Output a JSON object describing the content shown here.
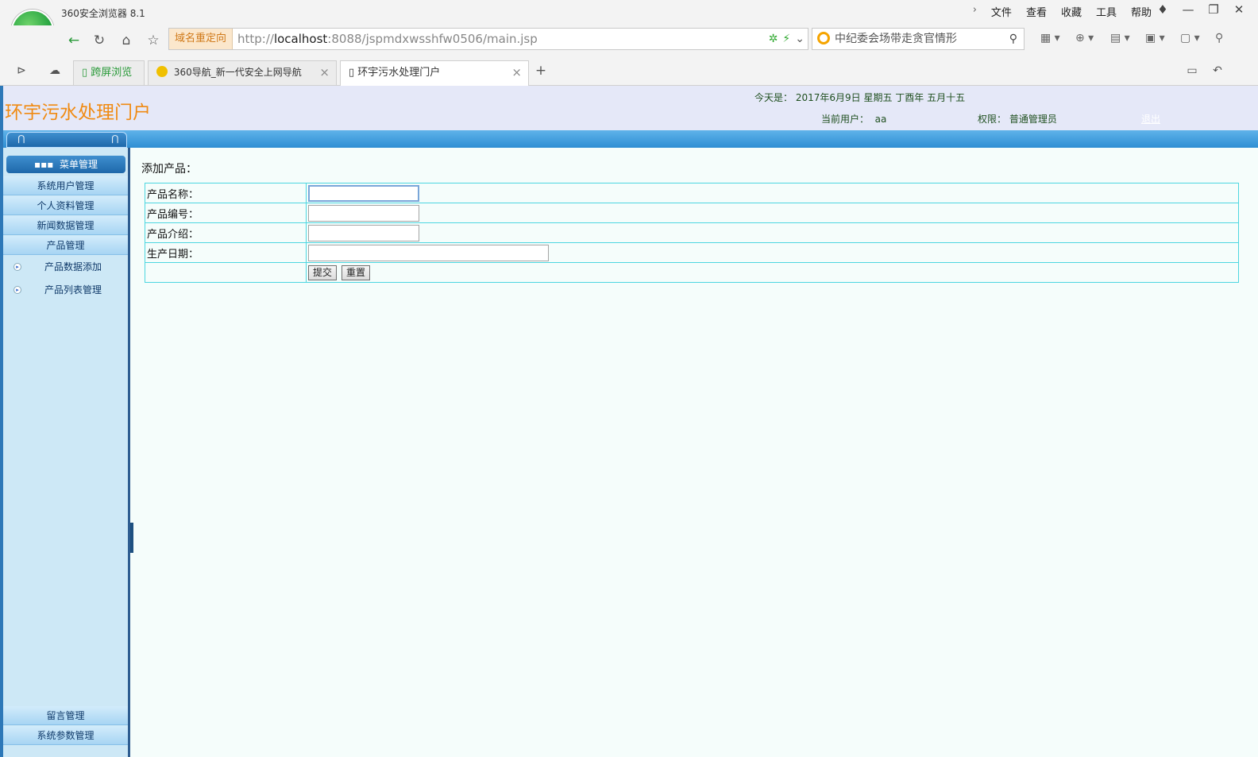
{
  "browser": {
    "app_title": "360安全浏览器 8.1",
    "logo_letter": "e",
    "menu": [
      "文件",
      "查看",
      "收藏",
      "工具",
      "帮助"
    ],
    "window_controls": [
      "shirt-icon",
      "minimize-icon",
      "restore-icon",
      "close-icon"
    ],
    "redirect_label": "域名重定向",
    "url_prefix": "http://",
    "url_host": "localhost",
    "url_rest": ":8088/jspmdxwsshfw0506/main.jsp",
    "search_text": "中纪委会场带走贪官情形",
    "tabs": [
      {
        "label": "跨屏浏览",
        "active": false
      },
      {
        "label": "360导航_新一代安全上网导航",
        "active": false
      },
      {
        "label": "环宇污水处理门户",
        "active": true
      }
    ]
  },
  "header": {
    "site_title": "环宇污水处理门户",
    "today": "今天是： 2017年6月9日  星期五  丁酉年  五月十五",
    "current_user_label": "当前用户：",
    "current_user": "aa",
    "role_label": "权限：",
    "role": "普通管理员",
    "logout": "退出"
  },
  "sidebar": {
    "menu_header": "菜单管理",
    "items": [
      {
        "label": "系统用户管理"
      },
      {
        "label": "个人资料管理"
      },
      {
        "label": "新闻数据管理"
      },
      {
        "label": "产品管理"
      }
    ],
    "sub_items": [
      {
        "label": "产品数据添加"
      },
      {
        "label": "产品列表管理"
      }
    ],
    "bottom_items": [
      {
        "label": "留言管理"
      },
      {
        "label": "系统参数管理"
      }
    ]
  },
  "form": {
    "title": "添加产品：",
    "fields": [
      {
        "label": "产品名称：",
        "value": ""
      },
      {
        "label": "产品编号：",
        "value": ""
      },
      {
        "label": "产品介绍：",
        "value": ""
      },
      {
        "label": "生产日期：",
        "value": ""
      }
    ],
    "submit_label": "提交",
    "reset_label": "重置"
  }
}
